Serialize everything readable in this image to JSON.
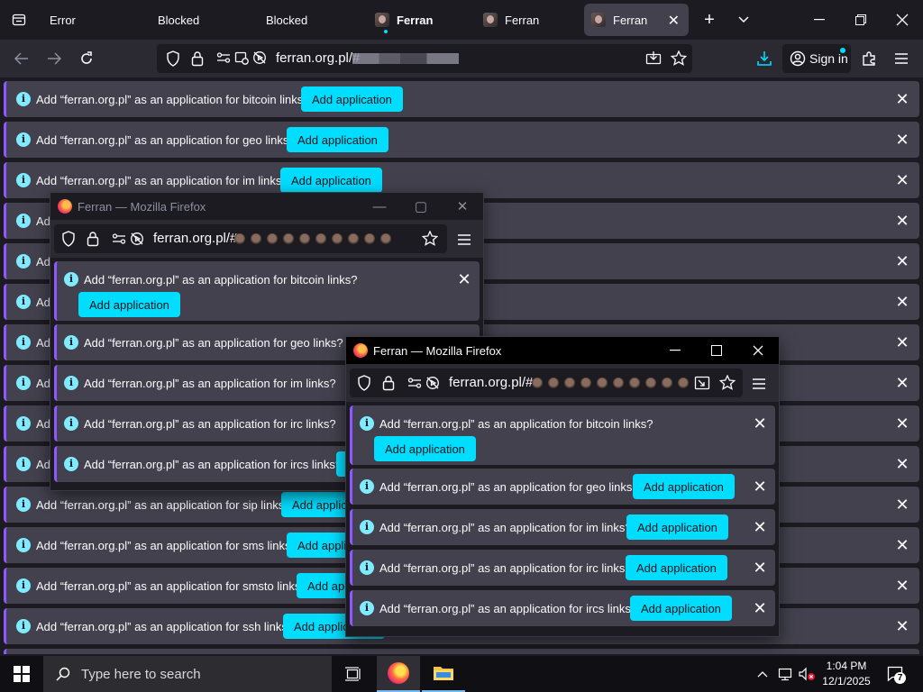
{
  "tabs": [
    {
      "label": "Error"
    },
    {
      "label": "Blocked"
    },
    {
      "label": "Blocked"
    },
    {
      "label": "Ferran"
    },
    {
      "label": "Ferran"
    },
    {
      "label": "Ferran"
    }
  ],
  "url": {
    "host": "ferran.org.pl/#"
  },
  "toolbar": {
    "sign_in": "Sign in"
  },
  "notification_button": "Add application",
  "main_notifications": [
    {
      "msg": "Add “ferran.org.pl” as an application for bitcoin links?"
    },
    {
      "msg": "Add “ferran.org.pl” as an application for geo links?"
    },
    {
      "msg": "Add “ferran.org.pl” as an application for im links?"
    },
    {
      "msg": "Add"
    },
    {
      "msg": "Add"
    },
    {
      "msg": "Add"
    },
    {
      "msg": "Add"
    },
    {
      "msg": "Add"
    },
    {
      "msg": "Add"
    },
    {
      "msg": "Add"
    },
    {
      "msg": "Add “ferran.org.pl” as an application for sip links?"
    },
    {
      "msg": "Add “ferran.org.pl” as an application for sms links?"
    },
    {
      "msg": "Add “ferran.org.pl” as an application for smsto links?"
    },
    {
      "msg": "Add “ferran.org.pl” as an application for ssh links?"
    }
  ],
  "popup1": {
    "title": "Ferran — Mozilla Firefox",
    "url": "ferran.org.pl/#",
    "notifications": [
      {
        "msg": "Add “ferran.org.pl” as an application for bitcoin links?"
      },
      {
        "msg": "Add “ferran.org.pl” as an application for geo links?"
      },
      {
        "msg": "Add “ferran.org.pl” as an application for im links?"
      },
      {
        "msg": "Add “ferran.org.pl” as an application for irc links?"
      },
      {
        "msg": "Add “ferran.org.pl” as an application for ircs links?"
      }
    ]
  },
  "popup2": {
    "title": "Ferran — Mozilla Firefox",
    "url": "ferran.org.pl/#",
    "notifications": [
      {
        "msg": "Add “ferran.org.pl” as an application for bitcoin links?"
      },
      {
        "msg": "Add “ferran.org.pl” as an application for geo links?"
      },
      {
        "msg": "Add “ferran.org.pl” as an application for im links?"
      },
      {
        "msg": "Add “ferran.org.pl” as an application for irc links?"
      },
      {
        "msg": "Add “ferran.org.pl” as an application for ircs links?"
      }
    ]
  },
  "taskbar": {
    "search_placeholder": "Type here to search",
    "time": "1:04 PM",
    "date": "12/1/2025",
    "notification_count": "7"
  },
  "colors": {
    "accent": "#00ddff",
    "notification_bg": "#42414d",
    "notification_border": "#9059ff"
  }
}
